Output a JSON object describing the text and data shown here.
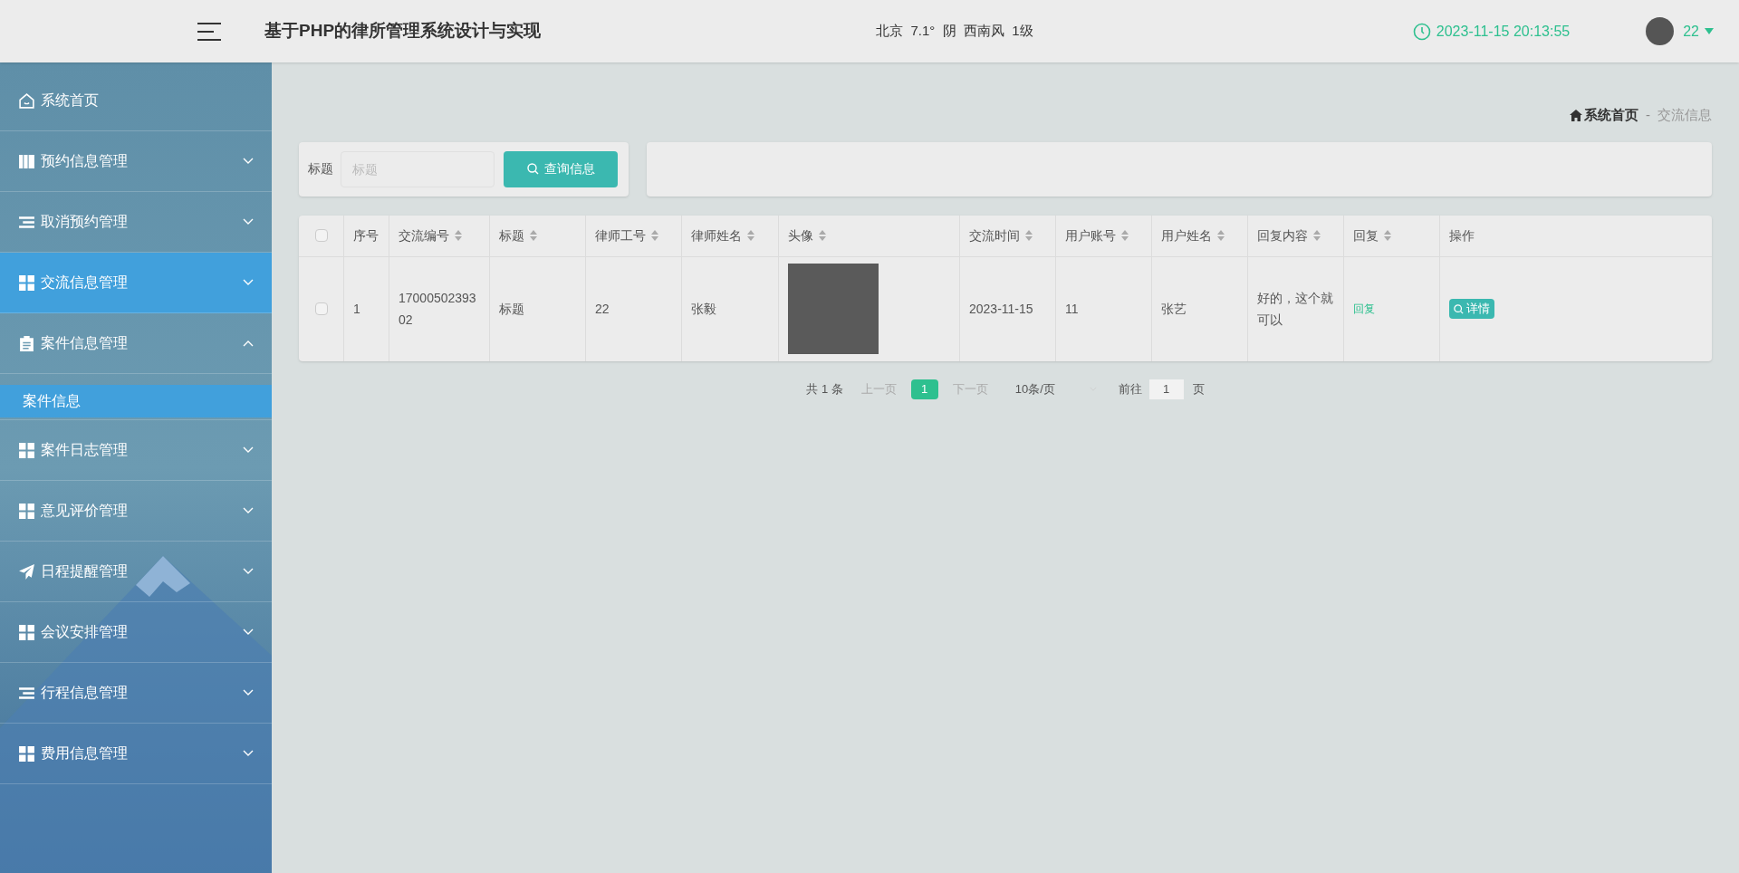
{
  "header": {
    "title": "基于PHP的律所管理系统设计与实现",
    "weather": "北京  7.1°  阴  西南风  1级",
    "datetime": "2023-11-15 20:13:55",
    "user": "22"
  },
  "sidebar": {
    "items": [
      {
        "label": "系统首页",
        "kind": "home",
        "selected": false
      },
      {
        "label": "预约信息管理",
        "kind": "book",
        "selected": false,
        "expanded": false
      },
      {
        "label": "取消预约管理",
        "kind": "list",
        "selected": false,
        "expanded": false
      },
      {
        "label": "交流信息管理",
        "kind": "grid",
        "selected": true,
        "expanded": false
      },
      {
        "label": "案件信息管理",
        "kind": "clipboard",
        "selected": false,
        "expanded": true,
        "children": [
          {
            "label": "案件信息",
            "selected": true
          }
        ]
      },
      {
        "label": "案件日志管理",
        "kind": "grid",
        "selected": false,
        "expanded": false
      },
      {
        "label": "意见评价管理",
        "kind": "grid",
        "selected": false,
        "expanded": false
      },
      {
        "label": "日程提醒管理",
        "kind": "plane",
        "selected": false,
        "expanded": false
      },
      {
        "label": "会议安排管理",
        "kind": "grid",
        "selected": false,
        "expanded": false
      },
      {
        "label": "行程信息管理",
        "kind": "list",
        "selected": false,
        "expanded": false
      },
      {
        "label": "费用信息管理",
        "kind": "grid",
        "selected": false,
        "expanded": false
      }
    ]
  },
  "breadcrumb": {
    "home": "系统首页",
    "separator": "-",
    "current": "交流信息"
  },
  "search": {
    "label": "标题",
    "placeholder": "标题",
    "button": "查询信息"
  },
  "table": {
    "select_all_checked": false,
    "columns": [
      {
        "label": "序号",
        "sortable": false
      },
      {
        "label": "交流编号",
        "sortable": true
      },
      {
        "label": "标题",
        "sortable": true
      },
      {
        "label": "律师工号",
        "sortable": true
      },
      {
        "label": "律师姓名",
        "sortable": true
      },
      {
        "label": "头像",
        "sortable": true
      },
      {
        "label": "交流时间",
        "sortable": true
      },
      {
        "label": "用户账号",
        "sortable": true
      },
      {
        "label": "用户姓名",
        "sortable": true
      },
      {
        "label": "回复内容",
        "sortable": true
      },
      {
        "label": "回复",
        "sortable": true
      },
      {
        "label": "操作",
        "sortable": false
      }
    ],
    "rows": [
      {
        "checked": false,
        "cells": [
          {
            "kind": "text",
            "text": "1"
          },
          {
            "kind": "text",
            "text": "1700050239302"
          },
          {
            "kind": "text",
            "text": "标题"
          },
          {
            "kind": "text",
            "text": "22"
          },
          {
            "kind": "text",
            "text": "张毅"
          },
          {
            "kind": "photo"
          },
          {
            "kind": "text",
            "text": "2023-11-15"
          },
          {
            "kind": "text",
            "text": "11"
          },
          {
            "kind": "text",
            "text": "张艺"
          },
          {
            "kind": "text",
            "text": "好的，这个就可以"
          },
          {
            "kind": "link",
            "text": "回复"
          },
          {
            "kind": "button",
            "text": "详情"
          }
        ]
      }
    ]
  },
  "pagination": {
    "total": "共 1 条",
    "prev": "上一页",
    "pages": [
      {
        "label": "1",
        "selected": true
      }
    ],
    "next": "下一页",
    "page_size": "10条/页",
    "goto_label": "前往",
    "goto_value": "1",
    "goto_suffix": "页"
  }
}
